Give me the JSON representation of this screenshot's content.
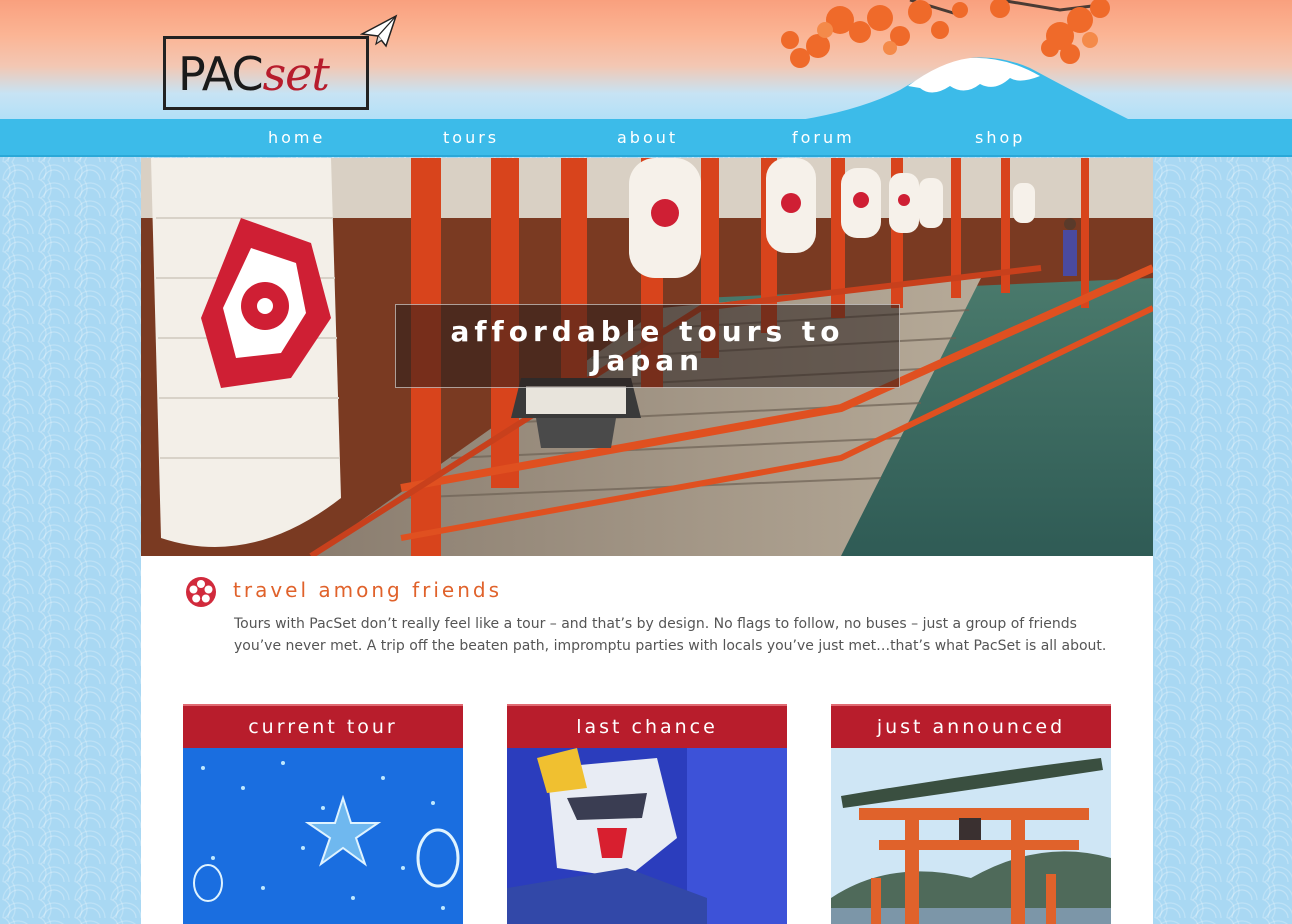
{
  "brand": {
    "logo_pac": "PAC",
    "logo_set": "set"
  },
  "nav": {
    "items": [
      {
        "label": "home"
      },
      {
        "label": "tours"
      },
      {
        "label": "about"
      },
      {
        "label": "forum"
      },
      {
        "label": "shop"
      }
    ]
  },
  "hero": {
    "caption": "affordable tours to Japan"
  },
  "about": {
    "title": "travel among friends",
    "text": "Tours with PacSet don’t really feel like a tour – and that’s by design. No flags to follow, no buses – just a group of friends you’ve never met. A trip off the beaten path, impromptu parties with locals you’ve just met…that’s what PacSet is all about."
  },
  "cards": [
    {
      "title": "current tour"
    },
    {
      "title": "last chance"
    },
    {
      "title": "just announced"
    }
  ],
  "colors": {
    "accent_red": "#b81d2c",
    "accent_orange": "#e0622b",
    "nav_blue": "#3cbbe9",
    "page_blue": "#a9d8f3"
  },
  "icons": {
    "plane": "paper-plane-icon",
    "flower": "sakura-flower-icon"
  }
}
